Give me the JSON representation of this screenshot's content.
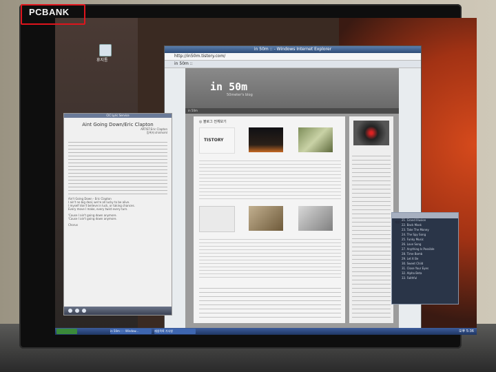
{
  "watermark": "PCBANK",
  "desktop": {
    "icon_label": "휴지통"
  },
  "ie": {
    "window_title": "in 50m :: - Windows Internet Explorer",
    "address": "http://in50m.tistory.com/",
    "tab": "in 50m ::",
    "blog_title": "in 50m",
    "blog_subtitle": "50meter's blog",
    "nav": "in 50m",
    "post_header": "◎ 블로그 전체보기",
    "tistory": "TISTORY"
  },
  "lyrics": {
    "header": "CIC Lyric Service",
    "title": "Aint Going Down/Eric Clapton",
    "artist": "ARTIST:Eric Clapton",
    "editor": "등록자:shinhsml",
    "lines": [
      "Ain't Going Down - Eric Clapton",
      "I ain't no big deal, we're all lucky to be alive.",
      "I myself don't believe in luck, or taking chances.",
      "Every move I make, every twist every turn.",
      "'Cause I ain't going down anymore.",
      "'Cause I ain't going down anymore.",
      "Chorus"
    ]
  },
  "taskbar": {
    "items": [
      "in 50m :: - Window...",
      "재생목록 가사창"
    ],
    "clock": "오후 5:36"
  },
  "playlist": {
    "title": "재생 목록",
    "rows": [
      "21. Grand Illusion",
      "22. Back Mask",
      "23. Take The Money",
      "24. The Spy Song",
      "25. Funky Music",
      "26. Love Song",
      "27. Anything Is Possible",
      "28. Time Bomb",
      "29. Let It Be",
      "30. Sweet Child",
      "31. Close Your Eyes",
      "32. Alpha Beta",
      "33. Faithful"
    ]
  },
  "colors": {
    "accent_red": "#e0141c",
    "xp_blue": "#1f3664"
  }
}
